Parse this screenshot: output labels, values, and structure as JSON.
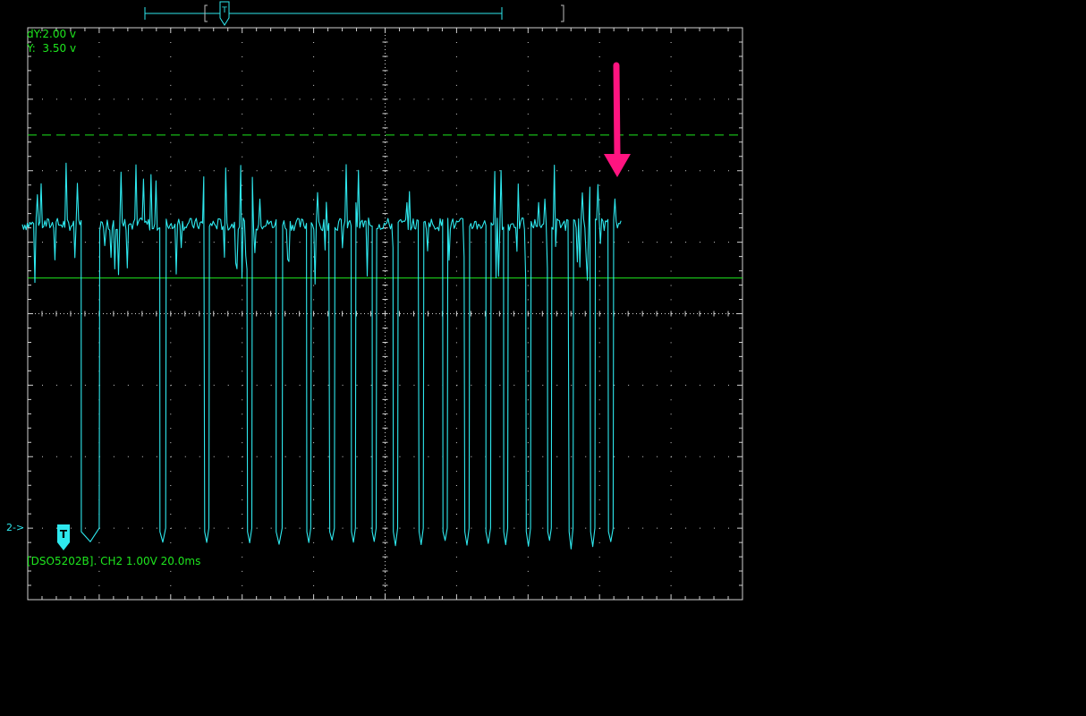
{
  "readout": {
    "dy": "dY:2.00 v",
    "y": "Y:  3.50 v"
  },
  "channel_marker": "2->",
  "trigger_marker": "T",
  "status_line": "[DSO5202B]. CH2 1.00V 20.0ms",
  "colors": {
    "background": "#000000",
    "graticule": "#d0d0d0",
    "trace": "#2ee8ee",
    "cursor": "#1ee61e",
    "text": "#1ee61e",
    "annotation_arrow": "#ff1480"
  },
  "chart_data": {
    "type": "line",
    "title": "",
    "xlabel": "",
    "ylabel": "",
    "grid": true,
    "x_divisions": 10,
    "y_divisions": 8,
    "time_per_div_ms": 20.0,
    "volts_per_div": 1.0,
    "xlim_ms": [
      0,
      200
    ],
    "ylim_div": [
      -4,
      4
    ],
    "series": [
      {
        "channel": "CH2",
        "high_level_div": 1.25,
        "low_level_div": -3.1,
        "idle_until_ms": 15,
        "pulses_ms": [
          [
            15,
            20
          ],
          [
            37,
            38.6
          ],
          [
            49.5,
            50.7
          ],
          [
            61.5,
            62.7
          ],
          [
            69.5,
            71.2
          ],
          [
            78.1,
            79.2
          ],
          [
            84.5,
            85.8
          ],
          [
            90.6,
            91.7
          ],
          [
            96.4,
            97.5
          ],
          [
            102.3,
            103.5
          ],
          [
            109.5,
            110.7
          ],
          [
            116.2,
            117.4
          ],
          [
            122.3,
            123.5
          ],
          [
            128.2,
            129.5
          ],
          [
            133.2,
            134.3
          ],
          [
            139.5,
            140.7
          ],
          [
            145.5,
            146.5
          ],
          [
            151.5,
            152.6
          ],
          [
            157.5,
            158.7
          ],
          [
            162.5,
            163.8
          ]
        ],
        "trace_end_ms": 166
      }
    ],
    "cursors": {
      "dashed_level_div": 2.5,
      "solid_level_div": 0.5
    }
  }
}
